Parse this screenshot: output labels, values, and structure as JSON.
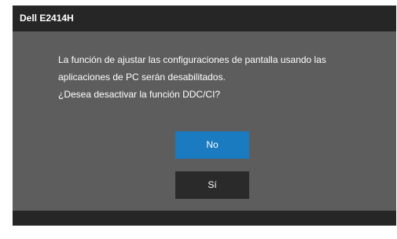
{
  "window": {
    "title": "Dell E2414H"
  },
  "dialog": {
    "message_lines": [
      "La función de ajustar las configuraciones de pantalla usando las",
      "aplicaciones de PC serán desabilitados.",
      "¿Desea desactivar la función DDC/CI?"
    ],
    "buttons": {
      "no_label": "No",
      "yes_label": "Sí"
    }
  },
  "colors": {
    "panel_background": "#5d5d5d",
    "title_bar": "#262626",
    "selected_button": "#1a7bc1",
    "unselected_button": "#2a2a2a",
    "text": "#ffffff"
  }
}
